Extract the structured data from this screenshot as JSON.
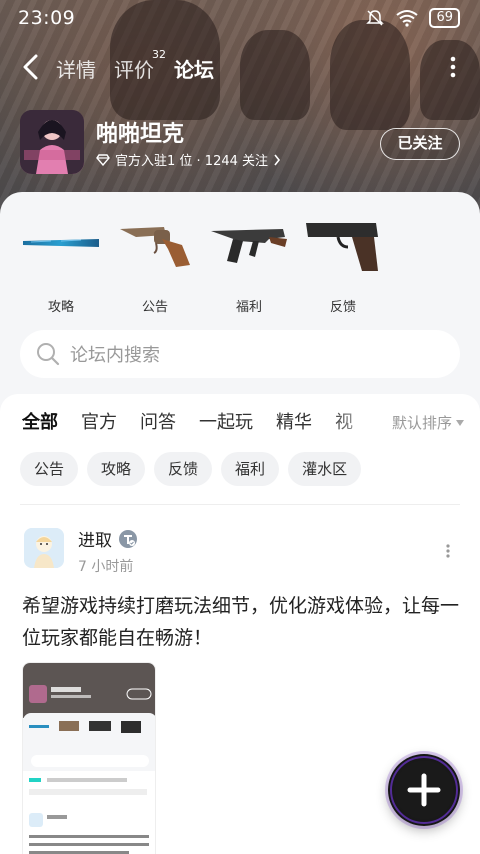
{
  "status_bar": {
    "time": "23:09",
    "battery": "69"
  },
  "nav": {
    "tabs": [
      {
        "label": "详情"
      },
      {
        "label": "评价",
        "badge": "32"
      },
      {
        "label": "论坛"
      }
    ],
    "active_tab": "论坛"
  },
  "game": {
    "title": "啪啪坦克",
    "subtitle": "官方入驻1 位 · 1244 关注",
    "follow_label": "已关注"
  },
  "categories": [
    {
      "label": "攻略",
      "icon": "baseball-bat-icon"
    },
    {
      "label": "公告",
      "icon": "revolver-icon"
    },
    {
      "label": "福利",
      "icon": "rifle-icon"
    },
    {
      "label": "反馈",
      "icon": "pistol-icon"
    }
  ],
  "search": {
    "placeholder": "论坛内搜索"
  },
  "forum_tabs": [
    "全部",
    "官方",
    "问答",
    "一起玩",
    "精华",
    "视"
  ],
  "sort_label": "默认排序",
  "chips": [
    "公告",
    "攻略",
    "反馈",
    "福利",
    "灌水区"
  ],
  "post": {
    "author": "进取",
    "time": "7 小时前",
    "content": "希望游戏持续打磨玩法细节，优化游戏体验，让每一位玩家都能自在畅游！"
  },
  "colors": {
    "accent": "#22d3c5",
    "panel_bg": "#f5f6f8"
  }
}
